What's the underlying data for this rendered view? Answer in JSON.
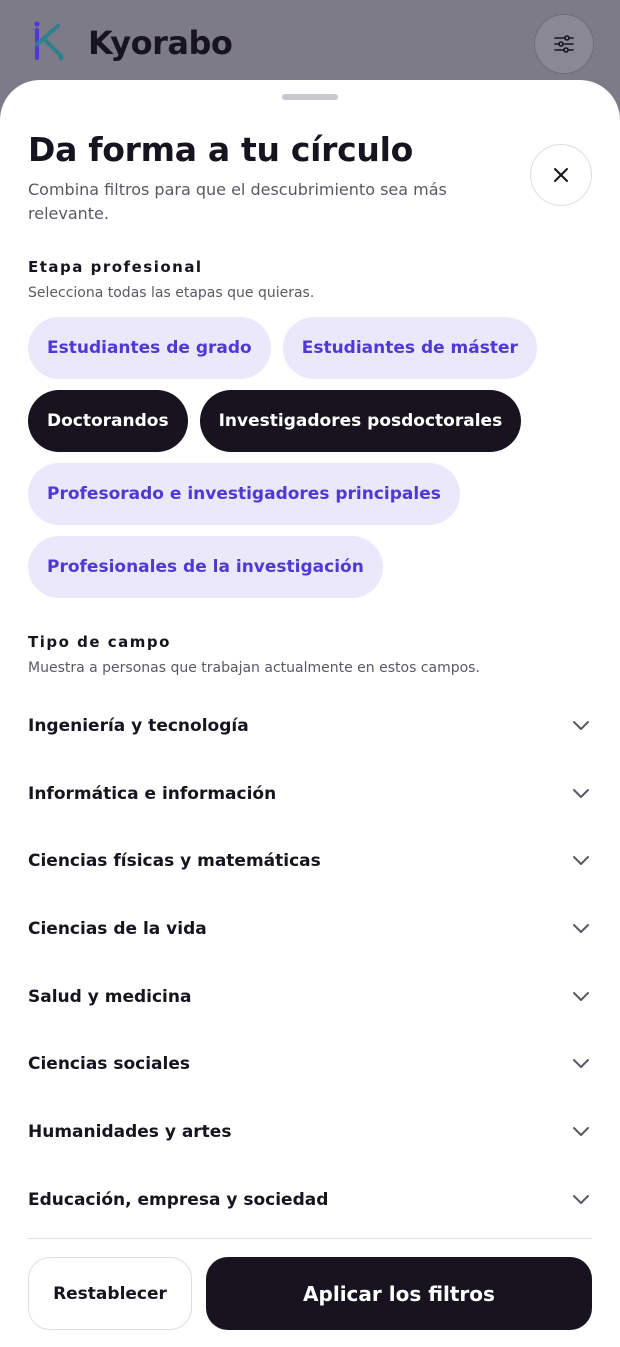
{
  "app": {
    "brand": "Kyorabo",
    "logo_icon": "kyorabo-k-logo",
    "filter_icon": "sliders-icon"
  },
  "sheet": {
    "title": "Da forma a tu círculo",
    "subtitle": "Combina filtros para que el descubrimiento sea más relevante.",
    "close_icon": "close-icon"
  },
  "career_stage": {
    "title": "Etapa profesional",
    "description": "Selecciona todas las etapas que quieras.",
    "rows": [
      [
        {
          "label": "Estudiantes de grado",
          "selected": false
        },
        {
          "label": "Estudiantes de máster",
          "selected": false
        }
      ],
      [
        {
          "label": "Doctorandos",
          "selected": true
        },
        {
          "label": "Investigadores posdoctorales",
          "selected": true
        }
      ],
      [
        {
          "label": "Profesorado e investigadores principales",
          "selected": false
        }
      ],
      [
        {
          "label": "Profesionales de la investigación",
          "selected": false
        }
      ]
    ]
  },
  "field_type": {
    "title": "Tipo de campo",
    "description": "Muestra a personas que trabajan actualmente en estos campos.",
    "items": [
      "Ingeniería y tecnología",
      "Informática e información",
      "Ciencias físicas y matemáticas",
      "Ciencias de la vida",
      "Salud y medicina",
      "Ciencias sociales",
      "Humanidades y artes",
      "Educación, empresa y sociedad"
    ]
  },
  "footer": {
    "reset_label": "Restablecer",
    "apply_label": "Aplicar los filtros"
  },
  "colors": {
    "accent": "#5138d4",
    "chip_bg": "#ebe8fc",
    "dark": "#17141f",
    "overlay": "#7d7b87"
  }
}
